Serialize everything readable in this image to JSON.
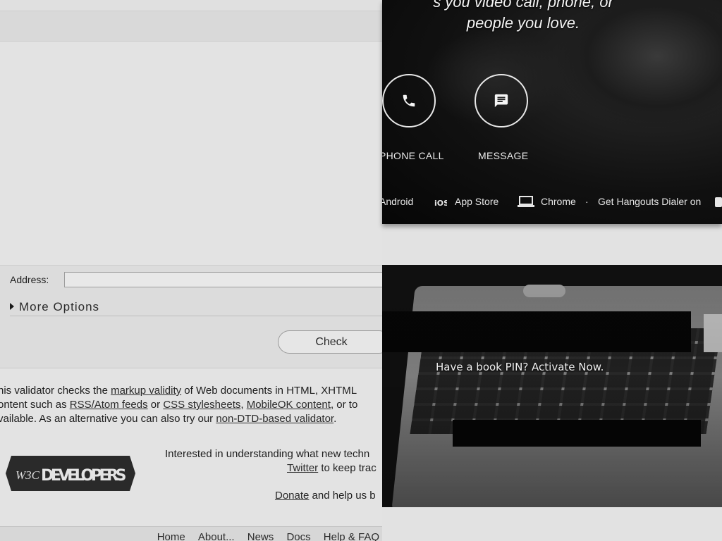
{
  "validator": {
    "address_label": "Address:",
    "address_value": "",
    "more_options": "More Options",
    "check_label": "Check",
    "intro": {
      "line1_prefix": "his validator checks the ",
      "line1_link": "markup validity",
      "line1_suffix": " of Web documents in HTML, XHTML",
      "line2_prefix": "ontent such as ",
      "line2_link1": "RSS/Atom feeds",
      "line2_or": " or ",
      "line2_link2": "CSS stylesheets",
      "line2_comma": ", ",
      "line2_link3": "MobileOK content",
      "line2_suffix": ", or to",
      "line3_prefix": "vailable. As an alternative you can also try our ",
      "line3_link": "non-DTD-based validator",
      "line3_suffix": "."
    },
    "w3c_logo_text": "DEVELOPERS",
    "w3c_badge": "W3C",
    "interest_line1": "Interested in understanding what new techn",
    "interest_link": "Twitter",
    "interest_line2_suffix": " to keep trac",
    "donate_link": "Donate",
    "donate_suffix": " and help us b",
    "footer_links": [
      "Home",
      "About...",
      "News",
      "Docs",
      "Help & FAQ"
    ]
  },
  "hangouts": {
    "hero_line1": "s you video call, phone, or",
    "hero_line2": "people you love.",
    "phone_label": "PHONE CALL",
    "message_label": "MESSAGE",
    "dialer_android": "Android",
    "dialer_appstore": "App Store",
    "dialer_chrome": "Chrome",
    "dialer_separator": "·",
    "dialer_get": "Get Hangouts Dialer on",
    "icons": [
      "phone-icon",
      "message-icon",
      "ios-icon",
      "laptop-icon",
      "android-icon"
    ]
  },
  "book_pin": {
    "text": "Have a book PIN? Activate Now."
  }
}
